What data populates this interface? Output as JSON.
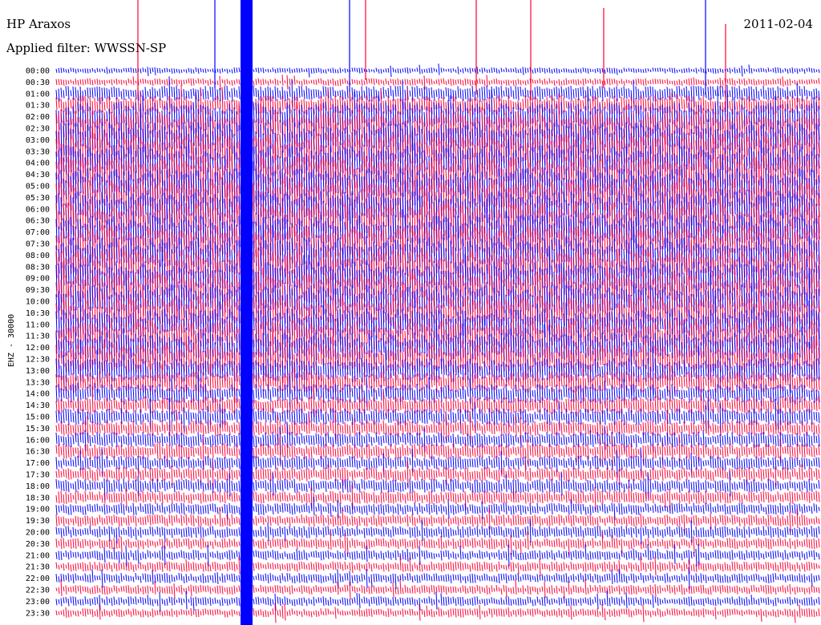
{
  "header": {
    "station": "HP Araxos",
    "date": "2011-02-04",
    "filter": "Applied filter: WWSSN-SP"
  },
  "chart_data": {
    "type": "line",
    "title": "HP Araxos",
    "subtitle": "Applied filter: WWSSN-SP",
    "channel_label": "EHZ - 30000",
    "rows": [
      "00:00",
      "00:30",
      "01:00",
      "01:30",
      "02:00",
      "02:30",
      "03:00",
      "03:30",
      "04:00",
      "04:30",
      "05:00",
      "05:30",
      "06:00",
      "06:30",
      "07:00",
      "07:30",
      "08:00",
      "08:30",
      "09:00",
      "09:30",
      "10:00",
      "10:30",
      "11:00",
      "11:30",
      "12:00",
      "12:30",
      "13:00",
      "13:30",
      "14:00",
      "14:30",
      "15:00",
      "15:30",
      "16:00",
      "16:30",
      "17:00",
      "17:30",
      "18:00",
      "18:30",
      "19:00",
      "19:30",
      "20:00",
      "20:30",
      "21:00",
      "21:30",
      "22:00",
      "22:30",
      "23:00",
      "23:30"
    ],
    "series_colors": [
      "#0000ff",
      "#ff0033"
    ],
    "row_amplitude": [
      0.18,
      0.22,
      0.45,
      0.55,
      0.85,
      0.95,
      1.0,
      1.0,
      1.0,
      1.0,
      1.0,
      1.0,
      1.0,
      1.0,
      1.0,
      1.0,
      1.0,
      0.95,
      0.95,
      0.95,
      0.95,
      0.95,
      0.9,
      0.9,
      0.85,
      0.85,
      0.7,
      0.6,
      0.55,
      0.5,
      0.48,
      0.45,
      0.45,
      0.45,
      0.4,
      0.4,
      0.4,
      0.38,
      0.35,
      0.35,
      0.35,
      0.32,
      0.3,
      0.3,
      0.3,
      0.28,
      0.28,
      0.26
    ],
    "grid": false,
    "legend": "none"
  }
}
